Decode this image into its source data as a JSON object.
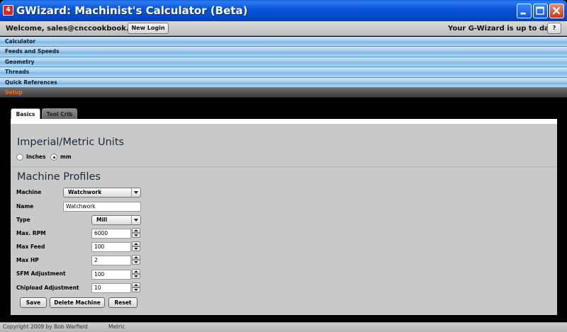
{
  "window": {
    "app_icon_text": "4",
    "title": "GWizard: Machinist's Calculator (Beta)",
    "controls": [
      "minimize-icon",
      "maximize-icon",
      "close-icon"
    ]
  },
  "header": {
    "welcome": "Welcome, sales@cnccookbook.com!",
    "new_login": "New Login",
    "status": "Your G-Wizard is up to date",
    "help": "?"
  },
  "nav": {
    "items": [
      {
        "label": "Calculator",
        "active": false
      },
      {
        "label": "Feeds and Speeds",
        "active": false
      },
      {
        "label": "Geometry",
        "active": false
      },
      {
        "label": "Threads",
        "active": false
      },
      {
        "label": "Quick References",
        "active": false
      },
      {
        "label": "Setup",
        "active": true
      }
    ]
  },
  "tabs": [
    {
      "label": "Basics",
      "selected": true
    },
    {
      "label": "Tool Crib",
      "selected": false
    }
  ],
  "units": {
    "title": "Imperial/Metric Units",
    "options": [
      {
        "label": "Inches",
        "selected": false
      },
      {
        "label": "mm",
        "selected": true
      }
    ]
  },
  "profiles": {
    "title": "Machine Profiles",
    "machine_label": "Machine",
    "machine_value": "Watchwork",
    "name_label": "Name",
    "name_value": "Watchwork",
    "type_label": "Type",
    "type_value": "Mill",
    "fields": [
      {
        "label": "Max. RPM",
        "value": "6000"
      },
      {
        "label": "Max Feed",
        "value": "100"
      },
      {
        "label": "Max HP",
        "value": "2"
      },
      {
        "label": "SFM Adjustment",
        "value": "100"
      },
      {
        "label": "Chipload Adjustment",
        "value": "10"
      }
    ],
    "buttons": {
      "save": "Save",
      "delete": "Delete Machine",
      "reset": "Reset"
    }
  },
  "footer": {
    "copyright": "Copyright 2009 by Bob Warfield",
    "mode": "Metric"
  },
  "colors": {
    "title_bar": "#0047c4",
    "nav_active_text": "#ff6a1a",
    "nav_bg": "#9fcbee"
  }
}
